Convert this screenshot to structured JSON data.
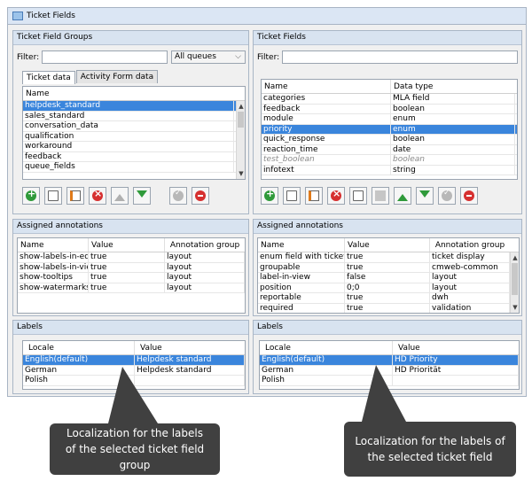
{
  "window": {
    "title": "Ticket Fields"
  },
  "groups_panel": {
    "title": "Ticket Field Groups",
    "filter_label": "Filter:",
    "filter_value": "",
    "queue_select": "All queues",
    "tabs": [
      {
        "label": "Ticket data",
        "active": true
      },
      {
        "label": "Activity Form data",
        "active": false
      }
    ],
    "list_header": "Name",
    "items": [
      "helpdesk_standard",
      "sales_standard",
      "conversation_data",
      "qualification",
      "workaround",
      "feedback",
      "queue_fields"
    ],
    "selected_index": 0
  },
  "fields_panel": {
    "title": "Ticket Fields",
    "filter_label": "Filter:",
    "filter_value": "",
    "columns": [
      "Name",
      "Data type"
    ],
    "rows": [
      [
        "categories",
        "MLA field"
      ],
      [
        "feedback",
        "boolean"
      ],
      [
        "module",
        "enum"
      ],
      [
        "priority",
        "enum"
      ],
      [
        "quick_response",
        "boolean"
      ],
      [
        "reaction_time",
        "date"
      ],
      [
        "test_boolean",
        "boolean"
      ],
      [
        "infotext",
        "string"
      ]
    ],
    "selected_index": 3,
    "disabled_index": 6
  },
  "annot_left": {
    "title": "Assigned annotations",
    "columns": [
      "Name",
      "Value",
      "Annotation group"
    ],
    "rows": [
      [
        "show-labels-in-edit",
        "true",
        "layout"
      ],
      [
        "show-labels-in-view",
        "true",
        "layout"
      ],
      [
        "show-tooltips",
        "true",
        "layout"
      ],
      [
        "show-watermarks",
        "true",
        "layout"
      ]
    ]
  },
  "annot_right": {
    "title": "Assigned annotations",
    "columns": [
      "Name",
      "Value",
      "Annotation group"
    ],
    "rows": [
      [
        "enum field with ticket c...",
        "true",
        "ticket display"
      ],
      [
        "groupable",
        "true",
        "cmweb-common"
      ],
      [
        "label-in-view",
        "false",
        "layout"
      ],
      [
        "position",
        "0;0",
        "layout"
      ],
      [
        "reportable",
        "true",
        "dwh"
      ],
      [
        "required",
        "true",
        "validation"
      ]
    ]
  },
  "labels_left": {
    "title": "Labels",
    "columns": [
      "Locale",
      "Value"
    ],
    "rows": [
      [
        "English(default)",
        "Helpdesk standard"
      ],
      [
        "German",
        "Helpdesk standard"
      ],
      [
        "Polish",
        ""
      ]
    ],
    "selected_index": 0
  },
  "labels_right": {
    "title": "Labels",
    "columns": [
      "Locale",
      "Value"
    ],
    "rows": [
      [
        "English(default)",
        "HD Priority"
      ],
      [
        "German",
        "HD Priorität"
      ],
      [
        "Polish",
        ""
      ]
    ],
    "selected_index": 0
  },
  "callouts": {
    "left": "Localization for the labels of the selected ticket field group",
    "right": "Localization for the labels of the selected ticket field"
  },
  "colors": {
    "selection": "#3a85dc",
    "panel_header": "#d8e3f0",
    "callout": "#404040"
  }
}
